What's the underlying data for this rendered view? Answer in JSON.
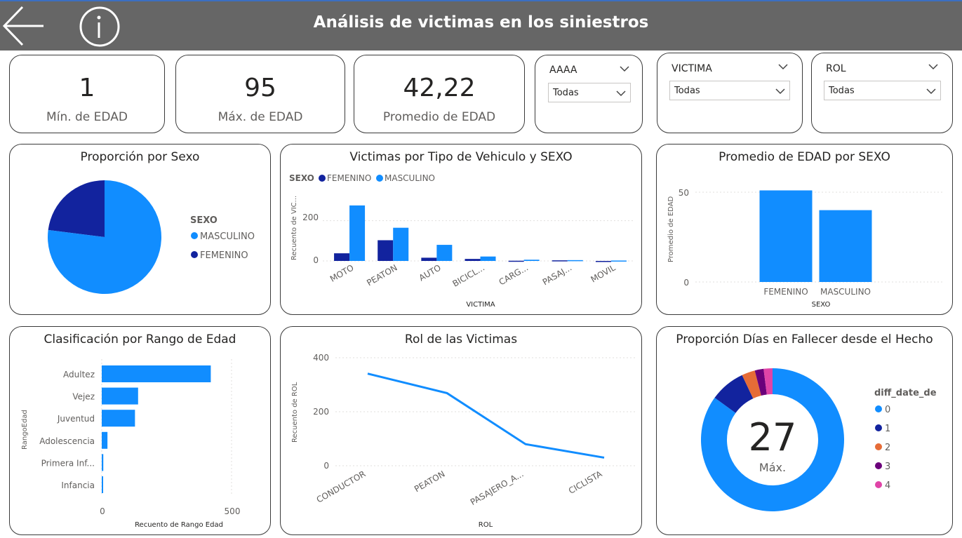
{
  "header": {
    "title": "Análisis de victimas en los siniestros",
    "back_icon": "arrow-left-icon",
    "info_icon": "info-icon"
  },
  "kpis": [
    {
      "value": "1",
      "label": "Mín. de EDAD"
    },
    {
      "value": "95",
      "label": "Máx. de EDAD"
    },
    {
      "value": "42,22",
      "label": "Promedio de EDAD"
    }
  ],
  "slicers": [
    {
      "title": "AAAA",
      "value": "Todas"
    },
    {
      "title": "VICTIMA",
      "value": "Todas"
    },
    {
      "title": "ROL",
      "value": "Todas"
    }
  ],
  "colors": {
    "masculino": "#118DFF",
    "femenino": "#12239E",
    "orange": "#E66C37",
    "purple": "#6B007B",
    "pink": "#E044A7"
  },
  "charts": {
    "sexo_pie": {
      "title": "Proporción por Sexo",
      "legend_title": "SEXO",
      "legend": [
        "MASCULINO",
        "FEMENINO"
      ]
    },
    "vehiculo": {
      "title": "Victimas por Tipo de Vehiculo y SEXO",
      "legend_title": "SEXO",
      "legend": [
        "FEMENINO",
        "MASCULINO"
      ],
      "ylabel": "Recuento de VIC...",
      "xlabel": "VICTIMA",
      "yticks": [
        "200",
        "0"
      ]
    },
    "edad_sexo": {
      "title": "Promedio de EDAD por SEXO",
      "ylabel": "Promedio de EDAD",
      "xlabel": "SEXO",
      "yticks": [
        "50",
        "0"
      ]
    },
    "rango": {
      "title": "Clasificación por Rango de Edad",
      "ylabel": "RangoEdad",
      "xlabel": "Recuento de Rango Edad",
      "xticks": [
        "0",
        "500"
      ]
    },
    "rol": {
      "title": "Rol de las Victimas",
      "ylabel": "Recuento de ROL",
      "xlabel": "ROL",
      "yticks": [
        "400",
        "200",
        "0"
      ]
    },
    "dias": {
      "title": "Proporción Días en Fallecer desde el Hecho",
      "legend_title": "diff_date_de",
      "legend": [
        "0",
        "1",
        "2",
        "3",
        "4"
      ],
      "center_value": "27",
      "center_label": "Máx."
    }
  },
  "chart_data": [
    {
      "type": "pie",
      "title": "Proporción por Sexo",
      "categories": [
        "MASCULINO",
        "FEMENINO"
      ],
      "values": [
        77,
        23
      ]
    },
    {
      "type": "bar",
      "title": "Victimas por Tipo de Vehiculo y SEXO",
      "categories": [
        "MOTO",
        "PEATON",
        "AUTO",
        "BICICL...",
        "CARG...",
        "PASAJ...",
        "MOVIL"
      ],
      "series": [
        {
          "name": "FEMENINO",
          "values": [
            38,
            103,
            16,
            10,
            1,
            3,
            0
          ]
        },
        {
          "name": "MASCULINO",
          "values": [
            276,
            165,
            80,
            22,
            6,
            4,
            2
          ]
        }
      ],
      "xlabel": "VICTIMA",
      "ylabel": "Recuento de VIC...",
      "ylim": [
        0,
        300
      ]
    },
    {
      "type": "bar",
      "title": "Promedio de EDAD por SEXO",
      "categories": [
        "FEMENINO",
        "MASCULINO"
      ],
      "values": [
        51,
        40
      ],
      "xlabel": "SEXO",
      "ylabel": "Promedio de EDAD",
      "ylim": [
        0,
        55
      ]
    },
    {
      "type": "bar",
      "title": "Clasificación por Rango de Edad",
      "categories": [
        "Adultez",
        "Vejez",
        "Juventud",
        "Adolescencia",
        "Primera Inf...",
        "Infancia"
      ],
      "values": [
        420,
        140,
        128,
        22,
        6,
        4
      ],
      "xlabel": "Recuento de Rango Edad",
      "ylabel": "RangoEdad",
      "xlim": [
        0,
        500
      ]
    },
    {
      "type": "line",
      "title": "Rol de las Victimas",
      "categories": [
        "CONDUCTOR",
        "PEATON",
        "PASAJERO_A...",
        "CICLISTA"
      ],
      "values": [
        341,
        269,
        80,
        30
      ],
      "xlabel": "ROL",
      "ylabel": "Recuento de ROL",
      "ylim": [
        0,
        400
      ]
    },
    {
      "type": "pie",
      "title": "Proporción Días en Fallecer desde el Hecho",
      "categories": [
        "0",
        "1",
        "2",
        "3",
        "4"
      ],
      "values": [
        85,
        8,
        3,
        2,
        2
      ]
    }
  ]
}
